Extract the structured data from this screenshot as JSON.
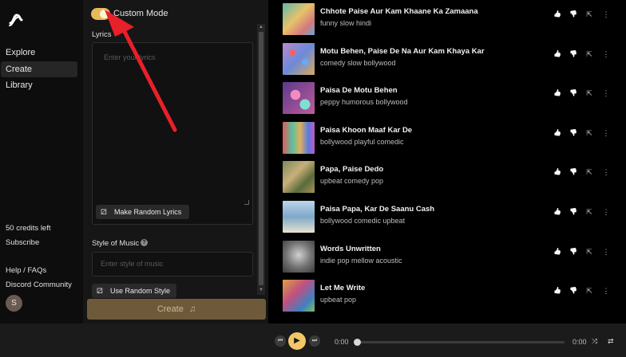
{
  "nav": {
    "items": [
      {
        "label": "Explore"
      },
      {
        "label": "Create"
      },
      {
        "label": "Library"
      }
    ],
    "credits": "50 credits left",
    "subscribe": "Subscribe",
    "help": "Help / FAQs",
    "discord": "Discord Community",
    "avatar_initial": "S"
  },
  "create": {
    "mode_label": "Custom Mode",
    "mode_on": true,
    "lyrics_label": "Lyrics",
    "lyrics_placeholder": "Enter your lyrics",
    "random_lyrics_button": "Make Random Lyrics",
    "style_label": "Style of Music",
    "style_placeholder": "Enter style of music",
    "random_style_button": "Use Random Style",
    "create_button": "Create"
  },
  "songs": [
    {
      "title": "Chhote Paise Aur Kam Khaane Ka Zamaana",
      "tags": "funny slow hindi"
    },
    {
      "title": "Motu Behen, Paise De Na Aur Kam Khaya Kar",
      "tags": "comedy slow bollywood"
    },
    {
      "title": "Paisa De Motu Behen",
      "tags": "peppy humorous bollywood"
    },
    {
      "title": "Paisa Khoon Maaf Kar De",
      "tags": "bollywood playful comedic"
    },
    {
      "title": "Papa, Paise Dedo",
      "tags": "upbeat comedy pop"
    },
    {
      "title": "Paisa Papa, Kar De Saanu Cash",
      "tags": "bollywood comedic upbeat"
    },
    {
      "title": "Words Unwritten",
      "tags": "indie pop mellow acoustic"
    },
    {
      "title": "Let Me Write",
      "tags": "upbeat pop"
    }
  ],
  "player": {
    "current_time": "0:00",
    "duration": "0:00"
  },
  "colors": {
    "accent": "#f2c766",
    "annotation_arrow": "#e8202a",
    "create_button": "#6e5a3a"
  },
  "icons": {
    "like": "thumbs-up-icon",
    "dislike": "thumbs-down-icon",
    "share": "share-icon",
    "more": "more-icon"
  }
}
